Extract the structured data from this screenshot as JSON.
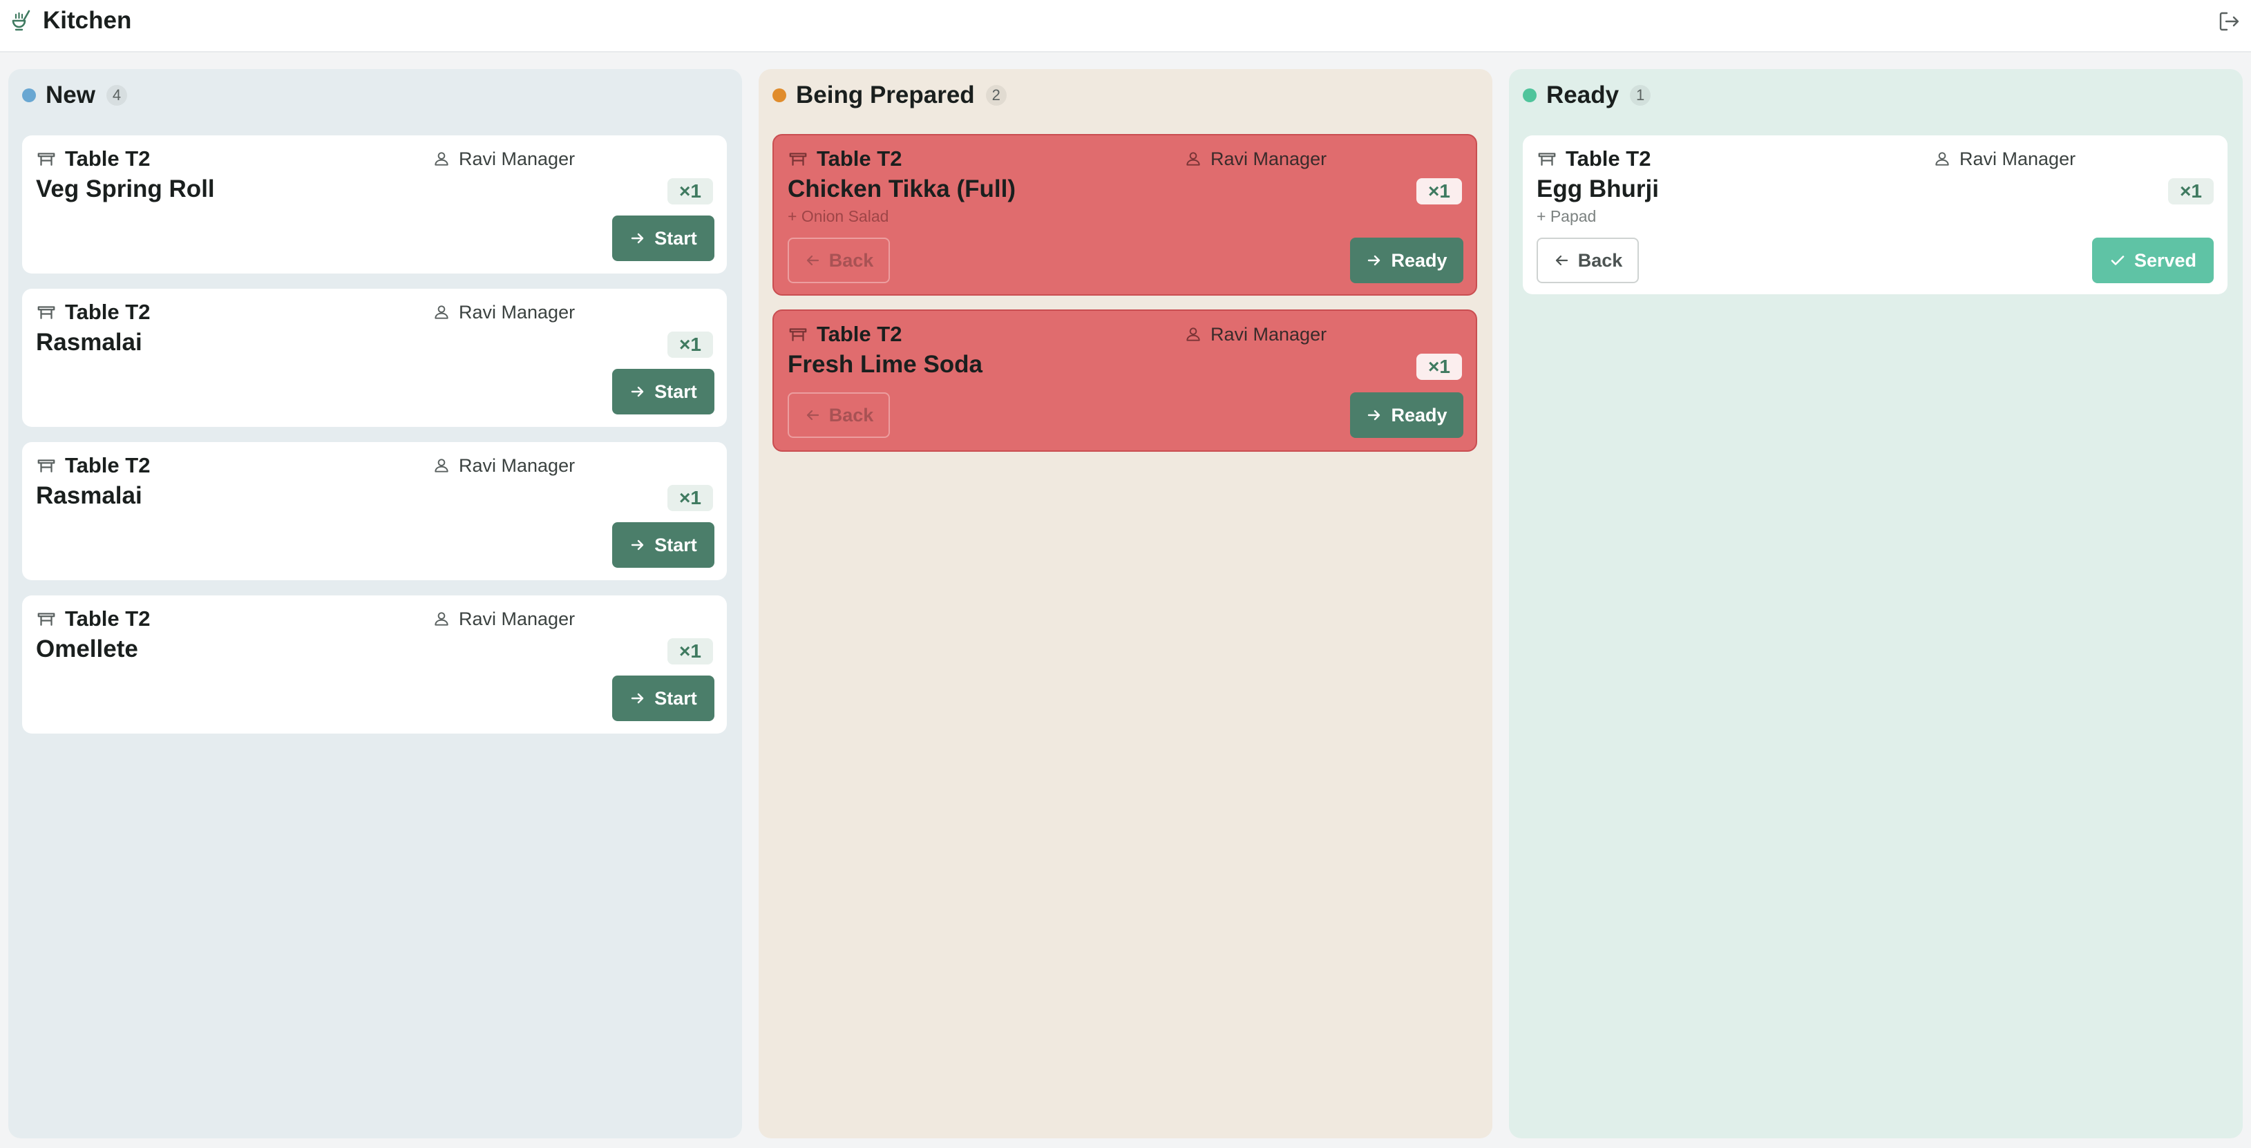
{
  "header": {
    "title": "Kitchen",
    "logo_icon": "chef-ladle-icon",
    "logout_icon": "logout-icon"
  },
  "colors": {
    "new": "#69a7d2",
    "prep": "#e08c2c",
    "ready": "#4fc49b",
    "urgent_card": "#e06c6e",
    "primary": "#4b7e6a",
    "served": "#5fc3a5"
  },
  "columns": [
    {
      "name": "New",
      "count": "4",
      "cards": [
        {
          "table": "Table T2",
          "waiter": "Ravi Manager",
          "item": "Veg Spring Roll",
          "qty": "×1",
          "action": "Start"
        },
        {
          "table": "Table T2",
          "waiter": "Ravi Manager",
          "item": "Rasmalai",
          "qty": "×1",
          "action": "Start"
        },
        {
          "table": "Table T2",
          "waiter": "Ravi Manager",
          "item": "Rasmalai",
          "qty": "×1",
          "action": "Start"
        },
        {
          "table": "Table T2",
          "waiter": "Ravi Manager",
          "item": "Omellete",
          "qty": "×1",
          "action": "Start"
        }
      ]
    },
    {
      "name": "Being Prepared",
      "count": "2",
      "cards": [
        {
          "table": "Table T2",
          "waiter": "Ravi Manager",
          "item": "Chicken Tikka (Full)",
          "addon": "+ Onion Salad",
          "qty": "×1",
          "back": "Back",
          "action": "Ready"
        },
        {
          "table": "Table T2",
          "waiter": "Ravi Manager",
          "item": "Fresh Lime Soda",
          "qty": "×1",
          "back": "Back",
          "action": "Ready"
        }
      ]
    },
    {
      "name": "Ready",
      "count": "1",
      "cards": [
        {
          "table": "Table T2",
          "waiter": "Ravi Manager",
          "item": "Egg Bhurji",
          "addon": "+ Papad",
          "qty": "×1",
          "back": "Back",
          "action": "Served"
        }
      ]
    }
  ]
}
